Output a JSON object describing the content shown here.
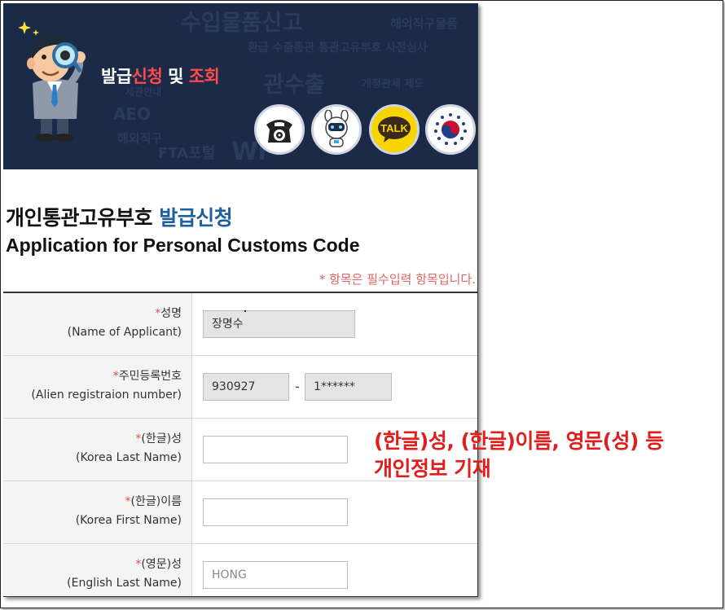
{
  "banner": {
    "title_part1": "발급",
    "title_part2": "신청",
    "title_part3": " 및 ",
    "title_part4": "조회",
    "watermark": [
      "수입물품신고",
      "해외직구물품",
      "환급 수출통관 통관고유부호 사전심사",
      "관수출",
      "개정관세 제도",
      "AEO",
      "해외직구",
      "FTA포털",
      "Wr",
      "세관안내"
    ],
    "icons": [
      "phone-icon",
      "robot-mascot-icon",
      "kakao-talk-icon",
      "government-emblem-icon"
    ],
    "talk_label": "TALK"
  },
  "heading": {
    "ko_part1": "개인통관고유부호",
    "ko_part2": " 발급신청",
    "en": "Application for Personal Customs Code"
  },
  "required_note": "* 항목은 필수입력 항목입니다.",
  "form": {
    "star": "*",
    "rows": [
      {
        "label_ko": "성명",
        "label_en": "(Name of Applicant)",
        "value": "장명수"
      },
      {
        "label_ko": "주민등록번호",
        "label_en": "(Alien registraion number)",
        "value_front": "930927",
        "separator": "-",
        "value_back": "1******"
      },
      {
        "label_ko": "(한글)성",
        "label_en": "(Korea Last Name)",
        "value": ""
      },
      {
        "label_ko": "(한글)이름",
        "label_en": "(Korea First Name)",
        "value": ""
      },
      {
        "label_ko": "(영문)성",
        "label_en": "(English Last Name)",
        "placeholder": "HONG"
      }
    ]
  },
  "annotation": {
    "line1": "(한글)성, (한글)이름, 영문(성) 등",
    "line2": "개인정보 기재"
  },
  "colors": {
    "banner_bg": "#1b2a47",
    "highlight_red": "#ff4b4b",
    "heading_blue": "#1f5fa0",
    "annotation_red": "#e01e1e",
    "required_note": "#e06464"
  }
}
